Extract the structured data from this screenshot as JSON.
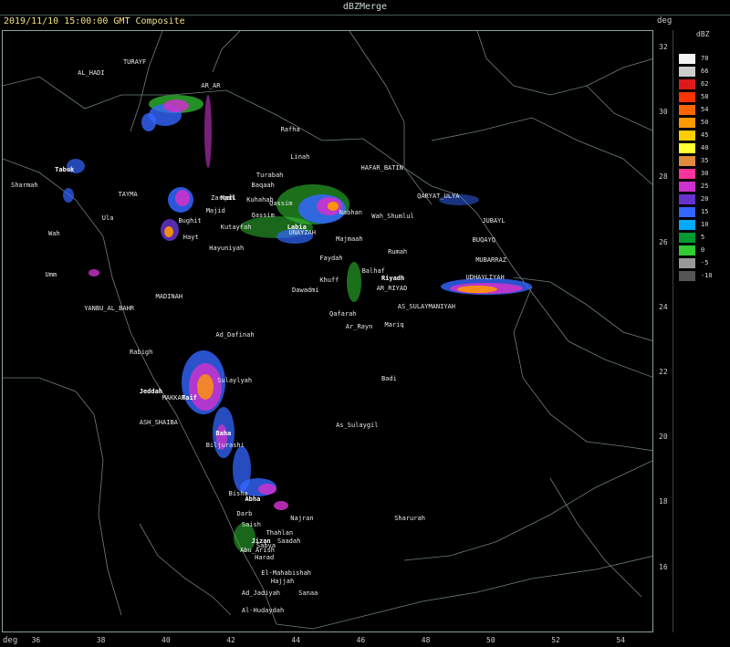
{
  "window_title": "dBZMerge",
  "subtitle": "2019/11/10 15:00:00 GMT Composite",
  "deg_label": "deg",
  "legend": {
    "title": "dBZ",
    "levels": [
      {
        "label": "70",
        "color": "#f2f2f2"
      },
      {
        "label": "66",
        "color": "#cccccc"
      },
      {
        "label": "62",
        "color": "#dd1a1a"
      },
      {
        "label": "58",
        "color": "#ff3300"
      },
      {
        "label": "54",
        "color": "#ff6600"
      },
      {
        "label": "50",
        "color": "#ff9900"
      },
      {
        "label": "45",
        "color": "#ffcc00"
      },
      {
        "label": "40",
        "color": "#ffff33"
      },
      {
        "label": "35",
        "color": "#e08a3c"
      },
      {
        "label": "30",
        "color": "#ff3399"
      },
      {
        "label": "25",
        "color": "#cc33cc"
      },
      {
        "label": "20",
        "color": "#6633cc"
      },
      {
        "label": "15",
        "color": "#3366ff"
      },
      {
        "label": "10",
        "color": "#00aaff"
      },
      {
        "label": "5",
        "color": "#009933"
      },
      {
        "label": "0",
        "color": "#33cc33"
      },
      {
        "label": "-5",
        "color": "#999999"
      },
      {
        "label": "-10",
        "color": "#555555"
      }
    ]
  },
  "lat_ticks": [
    "32",
    "30",
    "28",
    "26",
    "24",
    "22",
    "20",
    "18",
    "16"
  ],
  "lon_ticks": [
    "36",
    "38",
    "40",
    "42",
    "44",
    "46",
    "48",
    "50",
    "52",
    "54"
  ],
  "cities": [
    {
      "name": "TURAYF",
      "lon": 38.65,
      "lat": 31.68
    },
    {
      "name": "AL_HADI",
      "lon": 37.25,
      "lat": 31.35
    },
    {
      "name": "AR_AR",
      "lon": 41.05,
      "lat": 30.95
    },
    {
      "name": "Rafha",
      "lon": 43.5,
      "lat": 29.62
    },
    {
      "name": "Linah",
      "lon": 43.8,
      "lat": 28.76
    },
    {
      "name": "HAFAR_BATIN",
      "lon": 45.97,
      "lat": 28.43
    },
    {
      "name": "Turabah",
      "lon": 42.75,
      "lat": 28.2
    },
    {
      "name": "Baqaah",
      "lon": 42.6,
      "lat": 27.89
    },
    {
      "name": "Tabuk",
      "lon": 36.55,
      "lat": 28.38,
      "major": true
    },
    {
      "name": "Sharmah",
      "lon": 35.2,
      "lat": 27.9
    },
    {
      "name": "TAYMA",
      "lon": 38.5,
      "lat": 27.62
    },
    {
      "name": "QARYAT_ULYA",
      "lon": 47.7,
      "lat": 27.55
    },
    {
      "name": "Hail",
      "lon": 41.65,
      "lat": 27.5,
      "major": true
    },
    {
      "name": "Zarqah",
      "lon": 41.35,
      "lat": 27.5
    },
    {
      "name": "Kuhahah",
      "lon": 42.45,
      "lat": 27.45
    },
    {
      "name": "Qassim",
      "lon": 43.15,
      "lat": 27.35
    },
    {
      "name": "Majid",
      "lon": 41.2,
      "lat": 27.12
    },
    {
      "name": "Qassim",
      "lon": 42.6,
      "lat": 26.98
    },
    {
      "name": "Ula",
      "lon": 38.0,
      "lat": 26.9
    },
    {
      "name": "Nabhan",
      "lon": 45.3,
      "lat": 27.05
    },
    {
      "name": "Wah_Shumlul",
      "lon": 46.3,
      "lat": 26.95
    },
    {
      "name": "JUBAYL",
      "lon": 49.7,
      "lat": 26.8
    },
    {
      "name": "Bughit",
      "lon": 40.35,
      "lat": 26.8
    },
    {
      "name": "Kutayfah",
      "lon": 41.65,
      "lat": 26.6
    },
    {
      "name": "Labia",
      "lon": 43.7,
      "lat": 26.6,
      "major": true
    },
    {
      "name": "UNAYZAH",
      "lon": 43.75,
      "lat": 26.45
    },
    {
      "name": "Majmaah",
      "lon": 45.2,
      "lat": 26.25
    },
    {
      "name": "Wah",
      "lon": 36.35,
      "lat": 26.4
    },
    {
      "name": "Hayt",
      "lon": 40.5,
      "lat": 26.3
    },
    {
      "name": "BUQAYQ",
      "lon": 49.4,
      "lat": 26.2
    },
    {
      "name": "Hayuniyah",
      "lon": 41.3,
      "lat": 25.95
    },
    {
      "name": "Rumah",
      "lon": 46.8,
      "lat": 25.85
    },
    {
      "name": "MUBARRAZ",
      "lon": 49.5,
      "lat": 25.6
    },
    {
      "name": "Faydah",
      "lon": 44.7,
      "lat": 25.65
    },
    {
      "name": "Balhaf",
      "lon": 46.0,
      "lat": 25.25
    },
    {
      "name": "Riyadh",
      "lon": 46.6,
      "lat": 25.02,
      "major": true
    },
    {
      "name": "UDHAYLIYAH",
      "lon": 49.2,
      "lat": 25.05
    },
    {
      "name": "Khuff",
      "lon": 44.7,
      "lat": 24.97
    },
    {
      "name": "Umm",
      "lon": 36.25,
      "lat": 25.15
    },
    {
      "name": "Dawadmi",
      "lon": 43.85,
      "lat": 24.67
    },
    {
      "name": "AR_RIYAD",
      "lon": 46.45,
      "lat": 24.73
    },
    {
      "name": "MADINAH",
      "lon": 39.65,
      "lat": 24.46
    },
    {
      "name": "YANBU_AL_BAHR",
      "lon": 37.45,
      "lat": 24.1
    },
    {
      "name": "AS_SULAYMANIYAH",
      "lon": 47.1,
      "lat": 24.15
    },
    {
      "name": "Qafarah",
      "lon": 45.0,
      "lat": 23.95
    },
    {
      "name": "Mariq",
      "lon": 46.7,
      "lat": 23.6
    },
    {
      "name": "Ar_Rayn",
      "lon": 45.5,
      "lat": 23.55
    },
    {
      "name": "Ad_Dafinah",
      "lon": 41.5,
      "lat": 23.3
    },
    {
      "name": "Rabigh",
      "lon": 38.85,
      "lat": 22.75
    },
    {
      "name": "Sulaylyah",
      "lon": 41.55,
      "lat": 21.9
    },
    {
      "name": "Badi",
      "lon": 46.6,
      "lat": 21.93
    },
    {
      "name": "Jeddah",
      "lon": 39.15,
      "lat": 21.55,
      "major": true
    },
    {
      "name": "MAKKAH",
      "lon": 39.85,
      "lat": 21.35
    },
    {
      "name": "Taif",
      "lon": 40.45,
      "lat": 21.35,
      "major": true
    },
    {
      "name": "ASH_SHAIBA",
      "lon": 39.15,
      "lat": 20.6
    },
    {
      "name": "As_Sulaygil",
      "lon": 45.2,
      "lat": 20.5
    },
    {
      "name": "Baha",
      "lon": 41.5,
      "lat": 20.27,
      "major": true
    },
    {
      "name": "Biljurashi",
      "lon": 41.2,
      "lat": 19.9
    },
    {
      "name": "Abha",
      "lon": 42.4,
      "lat": 18.25,
      "major": true
    },
    {
      "name": "Bisha",
      "lon": 41.9,
      "lat": 18.4
    },
    {
      "name": "Najran",
      "lon": 43.8,
      "lat": 17.65
    },
    {
      "name": "Sharurah",
      "lon": 47.0,
      "lat": 17.65
    },
    {
      "name": "Darb",
      "lon": 42.15,
      "lat": 17.8
    },
    {
      "name": "Saish",
      "lon": 42.3,
      "lat": 17.45
    },
    {
      "name": "Thahlan",
      "lon": 43.05,
      "lat": 17.2
    },
    {
      "name": "Jizan",
      "lon": 42.6,
      "lat": 16.95,
      "major": true
    },
    {
      "name": "Sabya",
      "lon": 42.75,
      "lat": 16.8
    },
    {
      "name": "Saadah",
      "lon": 43.4,
      "lat": 16.95
    },
    {
      "name": "Abu_Arish",
      "lon": 42.25,
      "lat": 16.65
    },
    {
      "name": "Harad",
      "lon": 42.7,
      "lat": 16.45
    },
    {
      "name": "El-Mahabishah",
      "lon": 42.9,
      "lat": 15.95
    },
    {
      "name": "Hajjah",
      "lon": 43.2,
      "lat": 15.7
    },
    {
      "name": "Sanaa",
      "lon": 44.05,
      "lat": 15.35
    },
    {
      "name": "Ad_Jadiyah",
      "lon": 42.3,
      "lat": 15.35
    },
    {
      "name": "Al-Hudaydah",
      "lon": 42.3,
      "lat": 14.8
    }
  ]
}
